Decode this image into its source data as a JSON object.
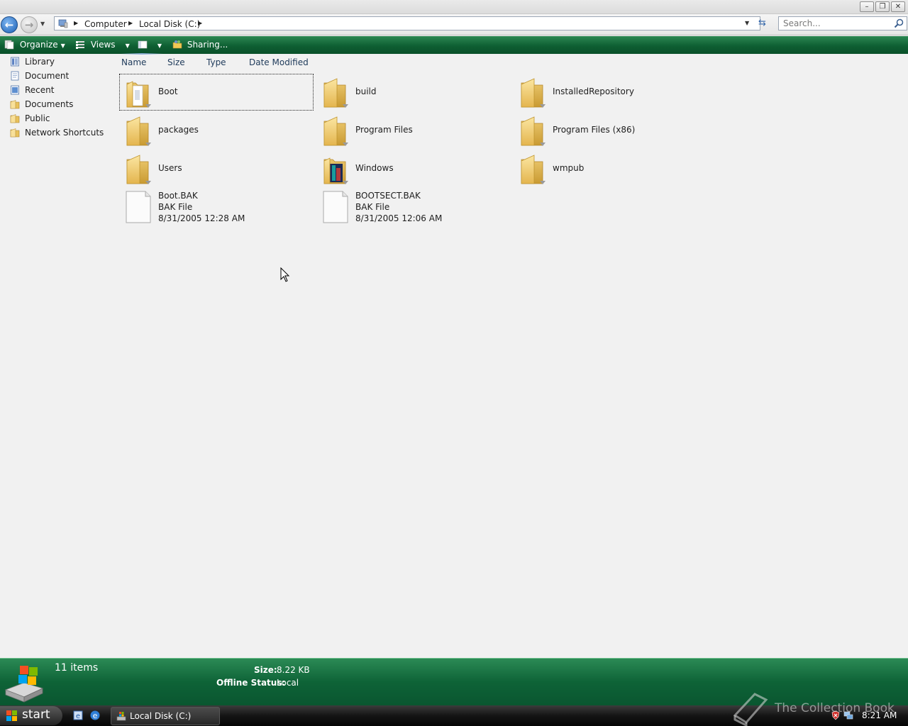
{
  "address": {
    "crumbs": [
      "Computer",
      "Local Disk (C:)"
    ]
  },
  "search": {
    "placeholder": "Search..."
  },
  "toolbar": {
    "organize_label": "Organize",
    "views_label": "Views",
    "sharing_label": "Sharing..."
  },
  "nav": {
    "items": [
      {
        "label": "Library",
        "icon": "library-icon"
      },
      {
        "label": "Document",
        "icon": "document-icon"
      },
      {
        "label": "Recent",
        "icon": "recent-icon"
      },
      {
        "label": "Documents",
        "icon": "folder-icon"
      },
      {
        "label": "Public",
        "icon": "folder-icon"
      },
      {
        "label": "Network Shortcuts",
        "icon": "folder-icon"
      }
    ]
  },
  "columns": [
    "Name",
    "Size",
    "Type",
    "Date Modified"
  ],
  "items": [
    {
      "name": "Boot",
      "kind": "folder",
      "icon": "folder-document-icon",
      "selected": true
    },
    {
      "name": "build",
      "kind": "folder",
      "icon": "folder-icon"
    },
    {
      "name": "InstalledRepository",
      "kind": "folder",
      "icon": "folder-icon"
    },
    {
      "name": "packages",
      "kind": "folder",
      "icon": "folder-icon"
    },
    {
      "name": "Program Files",
      "kind": "folder",
      "icon": "folder-icon"
    },
    {
      "name": "Program Files (x86)",
      "kind": "folder",
      "icon": "folder-icon"
    },
    {
      "name": "Users",
      "kind": "folder",
      "icon": "folder-icon"
    },
    {
      "name": "Windows",
      "kind": "folder",
      "icon": "folder-windows-icon"
    },
    {
      "name": "wmpub",
      "kind": "folder",
      "icon": "folder-icon"
    },
    {
      "name": "Boot.BAK",
      "kind": "file",
      "icon": "file-icon",
      "type": "BAK File",
      "date": "8/31/2005 12:28 AM"
    },
    {
      "name": "BOOTSECT.BAK",
      "kind": "file",
      "icon": "file-icon",
      "type": "BAK File",
      "date": "8/31/2005 12:06 AM"
    }
  ],
  "details": {
    "count": "11 items",
    "size_label": "Size:",
    "size_value": "8.22 KB",
    "offline_label": "Offline Status:",
    "offline_value": "Local"
  },
  "taskbar": {
    "start_label": "start",
    "task_label": "Local Disk (C:)",
    "clock": "8:21 AM"
  },
  "watermark": "The Collection Book",
  "colors": {
    "toolbar_green": "#0e5f33",
    "details_green": "#0e6337",
    "folder_yellow": "#f2cf6e",
    "accent_blue": "#1a5fb4"
  }
}
